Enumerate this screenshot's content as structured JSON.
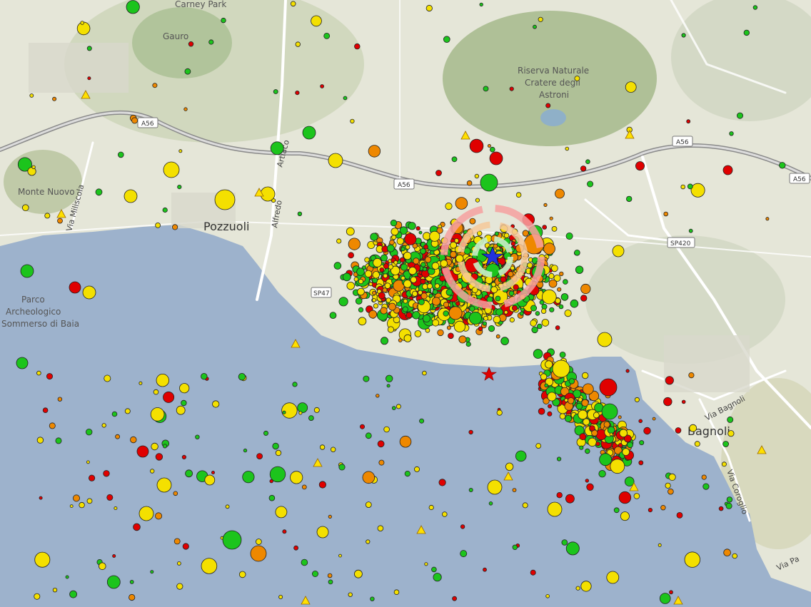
{
  "map": {
    "places": [
      {
        "key": "carney_park",
        "name": "Carney Park"
      },
      {
        "key": "gauro",
        "name": "Gauro"
      },
      {
        "key": "astroni",
        "name": "Riserva Naturale\nCratere degli\nAstroni"
      },
      {
        "key": "monte_nuovo",
        "name": "Monte Nuovo"
      },
      {
        "key": "pozzuoli",
        "name": "Pozzuoli"
      },
      {
        "key": "bagnoli",
        "name": "Bagnoli"
      },
      {
        "key": "parco",
        "name": "Parco\nArcheologico\nSommerso di Baia"
      }
    ],
    "roads": [
      {
        "key": "artiaco",
        "name": "Artiaco"
      },
      {
        "key": "alfredo",
        "name": "Alfredo"
      },
      {
        "key": "miliscola",
        "name": "Via Miliscola"
      },
      {
        "key": "via_bagnoli",
        "name": "Via Bagnoli"
      },
      {
        "key": "via_coroglio",
        "name": "Via Coroglio"
      },
      {
        "key": "via_pa",
        "name": "Via Pa"
      }
    ],
    "shields": [
      {
        "key": "a56_1",
        "label": "A56"
      },
      {
        "key": "a56_2",
        "label": "A56"
      },
      {
        "key": "a56_3",
        "label": "A56"
      },
      {
        "key": "a56_4",
        "label": "A56"
      },
      {
        "key": "sp420",
        "label": "SP420"
      },
      {
        "key": "sp4x",
        "label": "SP47"
      }
    ],
    "colors": {
      "sea": "#9db2cc",
      "land": "#e6e7da",
      "green_park": "#b8c8a2",
      "road": "#ffffff",
      "highway": "#8a8a8a"
    }
  },
  "seismicity": {
    "legend_colors": {
      "very_recent": "#e00000",
      "recent": "#ee8800",
      "older": "#f4e000",
      "oldest": "#1cc41c"
    },
    "stations_marker": "triangle",
    "epicenter_marker": "star"
  }
}
